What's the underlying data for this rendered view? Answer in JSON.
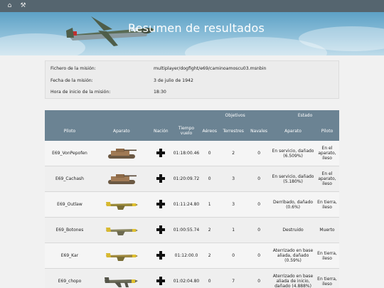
{
  "toolbar": {
    "icons": [
      "home-icon",
      "tools-icon"
    ]
  },
  "banner": {
    "title": "Resumen de resultados"
  },
  "mission_info": [
    {
      "label": "Fichero de la misión:",
      "value": "multiplayer/dogfight/e69/caminoamoscu03.msnbin"
    },
    {
      "label": "Fecha de la misión:",
      "value": "3 de julio de 1942"
    },
    {
      "label": "Hora de inicio de la misión:",
      "value": "18:30"
    }
  ],
  "table": {
    "group_headers": {
      "objectives": "Objetivos",
      "status": "Estado"
    },
    "columns": {
      "pilot": "Piloto",
      "aircraft": "Aparato",
      "nation": "Nación",
      "flight_time": "Tiempo vuelo",
      "air": "Aéreos",
      "ground": "Terrestres",
      "naval": "Navales",
      "status_aircraft": "Aparato",
      "status_pilot": "Piloto"
    },
    "rows": [
      {
        "pilot": "E69_VonPepofen",
        "craft_icon": "tank-icon",
        "nation_icon": "balkenkreuz-icon",
        "time": "01:18:00.46",
        "air": "0",
        "ground": "2",
        "naval": "0",
        "aircraft_status": "En servicio, dañado (6.509%)",
        "pilot_status": "En el aparato, ileso"
      },
      {
        "pilot": "E69_Cachash",
        "craft_icon": "tank-icon",
        "nation_icon": "balkenkreuz-icon",
        "time": "01:20:09.72",
        "air": "0",
        "ground": "3",
        "naval": "0",
        "aircraft_status": "En servicio, dañado (5.180%)",
        "pilot_status": "En el aparato, ileso"
      },
      {
        "pilot": "E69_Outlaw",
        "craft_icon": "fighter-plane-icon",
        "nation_icon": "balkenkreuz-icon",
        "time": "01:11:24.80",
        "air": "1",
        "ground": "3",
        "naval": "0",
        "aircraft_status": "Derribado, dañado (0.6%)",
        "pilot_status": "En tierra, ileso"
      },
      {
        "pilot": "E69_Botones",
        "craft_icon": "fighter-plane-icon",
        "nation_icon": "balkenkreuz-icon",
        "time": "01:00:55.74",
        "air": "2",
        "ground": "1",
        "naval": "0",
        "aircraft_status": "Destruido",
        "pilot_status": "Muerto"
      },
      {
        "pilot": "E69_Kar",
        "craft_icon": "fighter-plane-icon",
        "nation_icon": "balkenkreuz-icon",
        "time": "01:12:00.0",
        "air": "2",
        "ground": "0",
        "naval": "0",
        "aircraft_status": "Aterrizado en base aliada, dañado (0.59%)",
        "pilot_status": "En tierra, ileso"
      },
      {
        "pilot": "E69_chopo",
        "craft_icon": "dive-bomber-icon",
        "nation_icon": "balkenkreuz-icon",
        "time": "01:02:04.80",
        "air": "0",
        "ground": "7",
        "naval": "0",
        "aircraft_status": "Aterrizado en base aliada de inicio, dañado (4.888%)",
        "pilot_status": "En tierra, ileso"
      }
    ]
  }
}
